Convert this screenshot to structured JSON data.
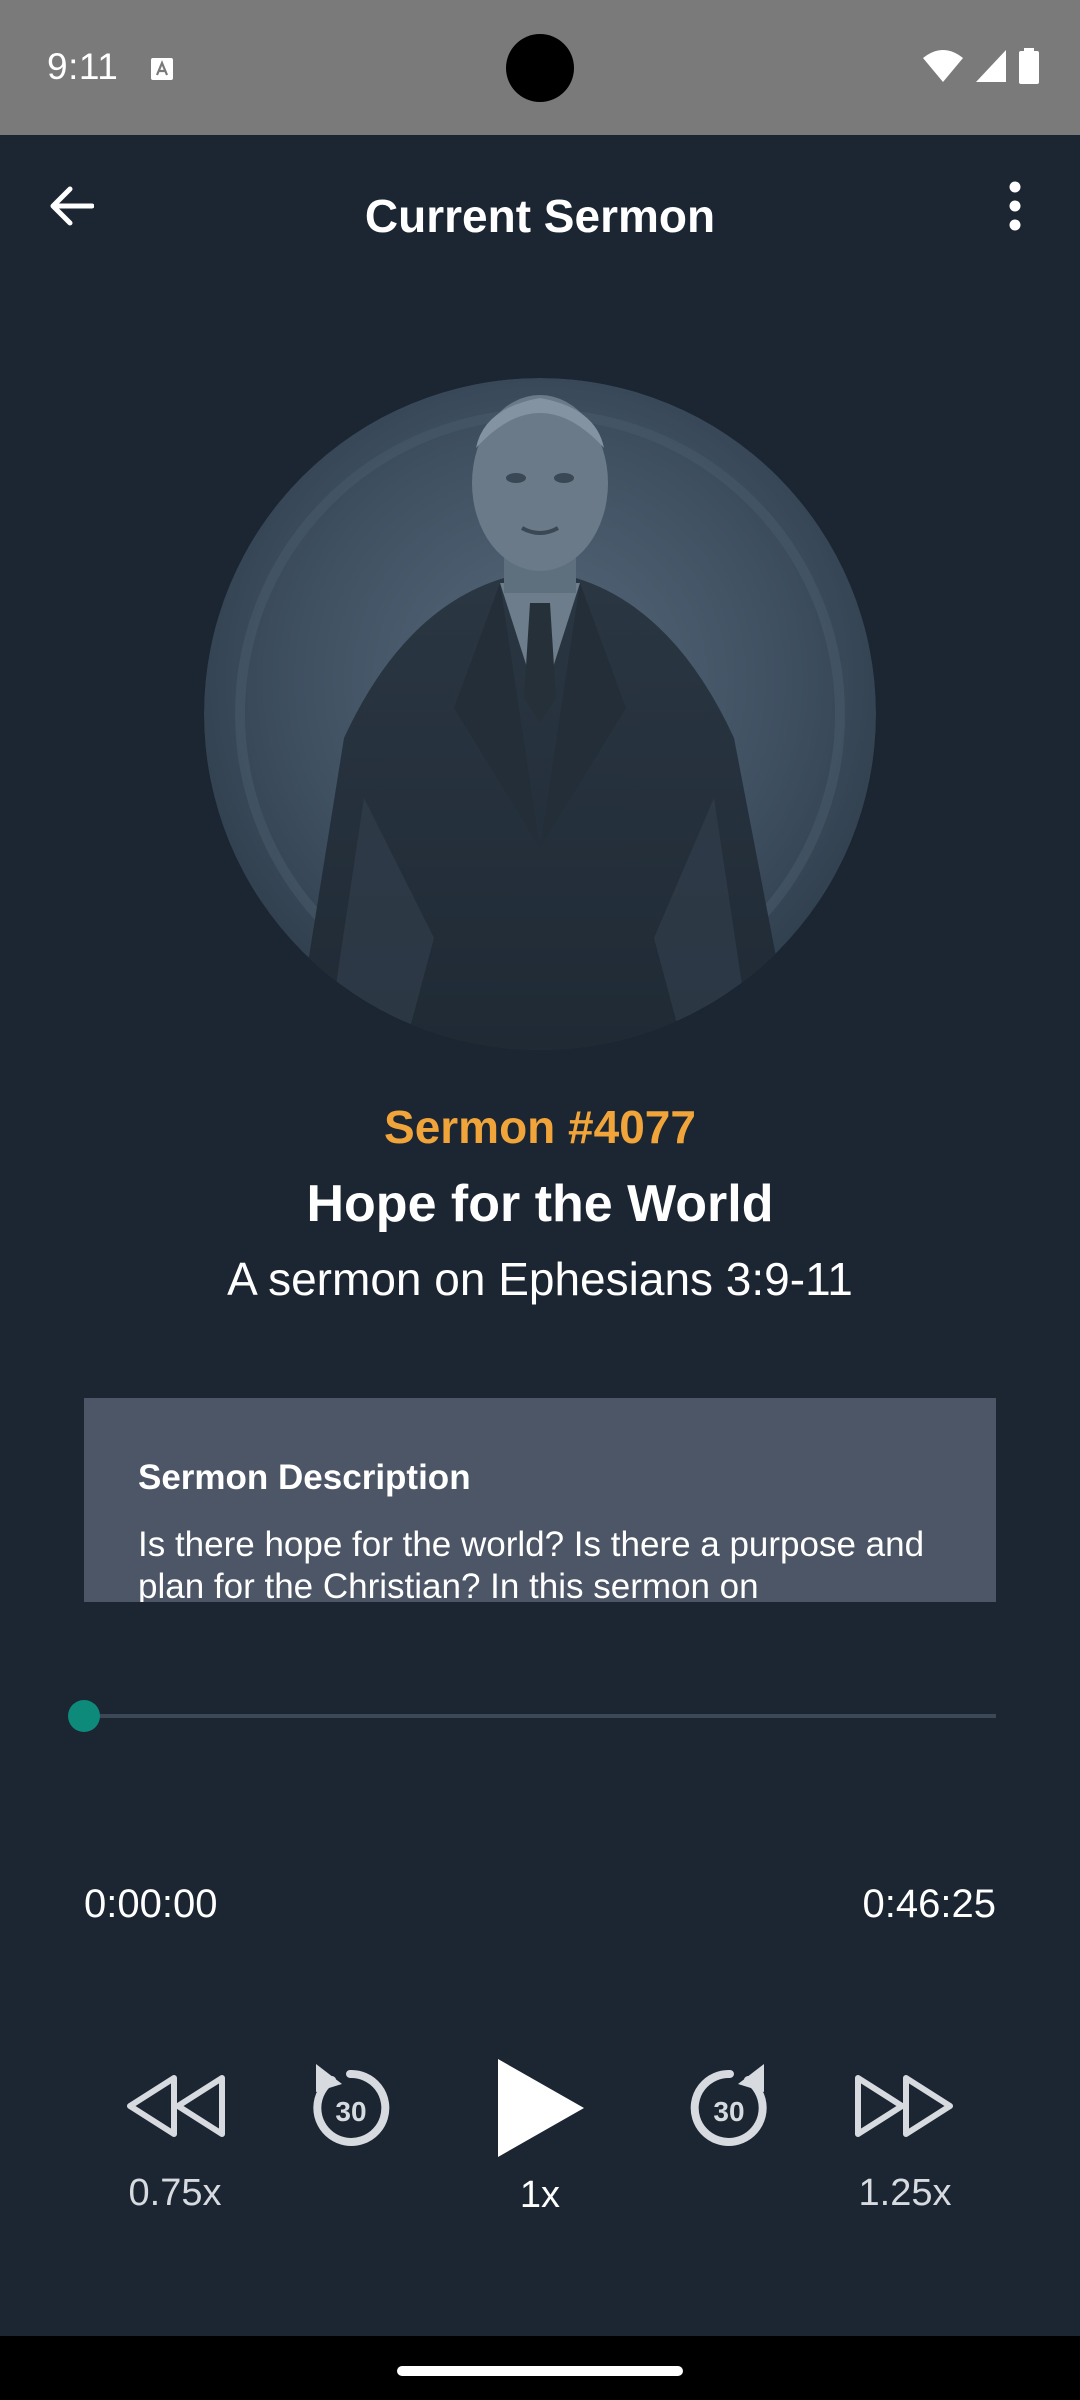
{
  "status_bar": {
    "time": "9:11",
    "icons": [
      "a-notification-icon",
      "wifi-icon",
      "signal-icon",
      "battery-icon"
    ]
  },
  "app_bar": {
    "title": "Current Sermon",
    "back_icon": "arrow-back-icon",
    "more_icon": "more-vert-icon"
  },
  "sermon": {
    "number": "Sermon #4077",
    "title": "Hope for the World",
    "subtitle": "A sermon on Ephesians 3:9-11",
    "artwork": "preacher-portrait"
  },
  "description": {
    "heading": "Sermon Description",
    "body": "Is there hope for the world? Is there a purpose and plan for the Christian? In this sermon on"
  },
  "player": {
    "progress_fraction": 0.0,
    "current_time": "0:00:00",
    "total_time": "0:46:25",
    "controls": {
      "slow_label": "0.75x",
      "rewind_seconds": "30",
      "normal_label": "1x",
      "forward_seconds": "30",
      "fast_label": "1.25x"
    }
  },
  "colors": {
    "background": "#1b2632",
    "accent_orange": "#f0a43a",
    "accent_teal": "#0e8a7a",
    "card": "#4d5667",
    "status_bar": "#7a7a7a"
  }
}
